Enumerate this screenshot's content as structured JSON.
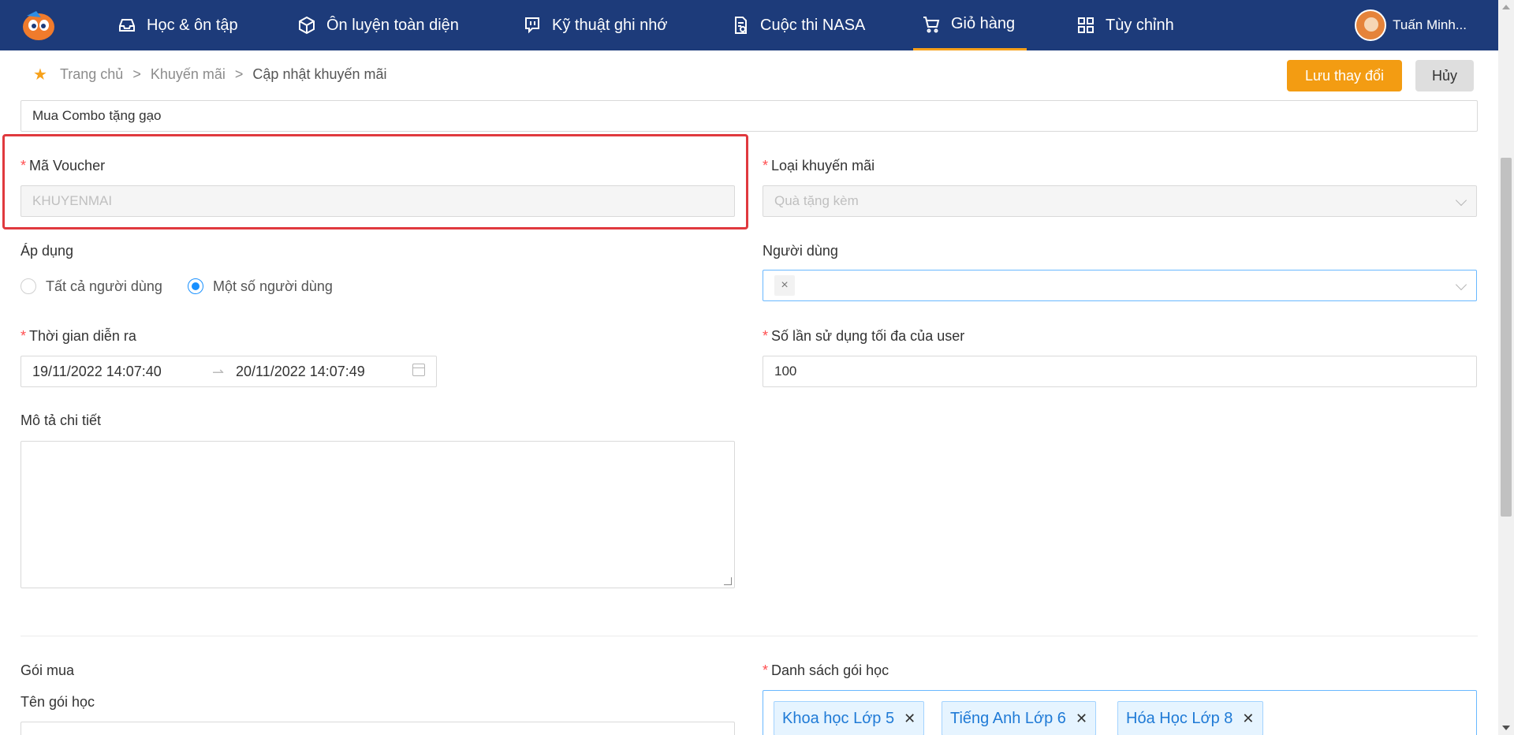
{
  "nav": {
    "items": [
      {
        "label": "Học & ôn tập",
        "icon": "inbox-icon"
      },
      {
        "label": "Ôn luyện toàn diện",
        "icon": "box-icon"
      },
      {
        "label": "Kỹ thuật ghi nhớ",
        "icon": "chat-icon"
      },
      {
        "label": "Cuộc thi NASA",
        "icon": "document-icon"
      },
      {
        "label": "Giỏ hàng",
        "icon": "cart-icon"
      },
      {
        "label": "Tùy chỉnh",
        "icon": "grid-icon"
      }
    ],
    "active": "Giỏ hàng",
    "user_name": "Tuấn Minh..."
  },
  "breadcrumb": {
    "home": "Trang chủ",
    "section": "Khuyến mãi",
    "current": "Cập nhật khuyến mãi",
    "separator": ">"
  },
  "actions": {
    "save_label": "Lưu thay đổi",
    "cancel_label": "Hủy"
  },
  "form": {
    "name_value": "Mua Combo tặng gạo",
    "voucher_label": "Mã Voucher",
    "voucher_value": "KHUYENMAI",
    "promo_type_label": "Loại khuyến mãi",
    "promo_type_value": "Quà tặng kèm",
    "apply_label": "Áp dụng",
    "apply_options": [
      "Tất cả người dùng",
      "Một số người dùng"
    ],
    "apply_selected": "Một số người dùng",
    "users_label": "Người dùng",
    "users_tag_remove": "×",
    "time_label": "Thời gian diễn ra",
    "time_start": "19/11/2022 14:07:40",
    "time_end": "20/11/2022 14:07:49",
    "max_use_label": "Số lần sử dụng tối đa của user",
    "max_use_value": "100",
    "description_label": "Mô tả chi tiết",
    "package_label": "Gói mua",
    "package_name_label": "Tên gói học",
    "course_list_label": "Danh sách gói học",
    "course_tags": [
      "Khoa học Lớp 5",
      "Tiếng Anh Lớp 6",
      "Hóa Học Lớp 8"
    ]
  },
  "colors": {
    "nav_bg": "#1d3b7a",
    "accent": "#f39c12",
    "required": "#ff4d4f",
    "highlight": "#e0393e",
    "primary": "#1890ff"
  }
}
